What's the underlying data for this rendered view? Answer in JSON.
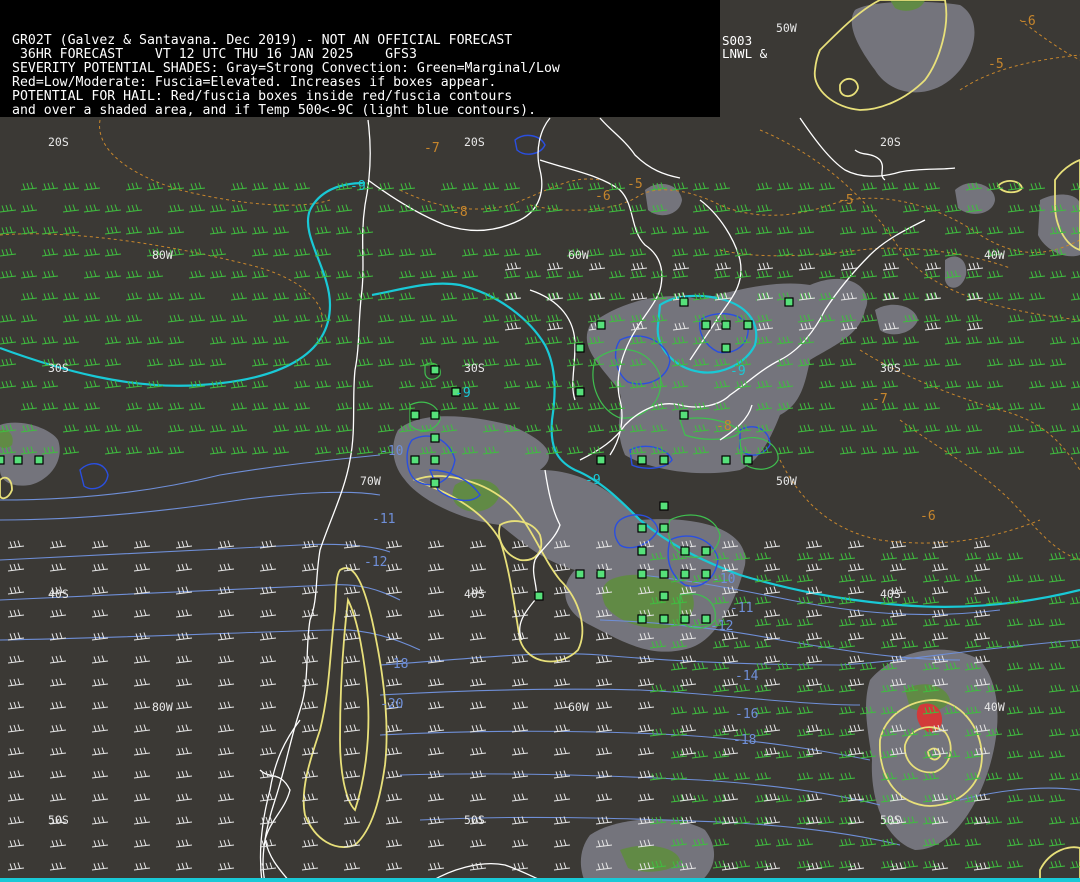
{
  "header": {
    "lines": [
      "GR02T (Galvez & Santavana. Dec 2019) - NOT AN OFFICIAL FORECAST",
      " 36HR FORECAST    VT 12 UTC THU 16 JAN 2025    GFS3",
      "SEVERITY POTENTIAL SHADES: Gray=Strong Convection: Green=Marginal/Low",
      "Red=Low/Moderate: Fuscia=Elevated. Increases if boxes appear.",
      "POTENTIAL FOR HAIL: Red/fuscia boxes inside red/fuscia contours",
      "and over a shaded area, and if Temp 500<-9C (light blue contours)."
    ],
    "corner_code_1": "S003",
    "corner_code_2": "LNWL &"
  },
  "grid_labels": {
    "lat_20s": "20S",
    "lat_30s": "30S",
    "lat_40s": "40S",
    "lat_50s": "50S",
    "lon_80w": "80W",
    "lon_70w": "70W",
    "lon_60w": "60W",
    "lon_50w": "50W",
    "lon_40w": "40W"
  },
  "isotherm_labels": {
    "m5": "-5",
    "m6": "-6",
    "m7": "-7",
    "m8": "-8",
    "m9": "-9",
    "m10": "-10",
    "m11": "-11",
    "m12": "-12",
    "m14": "-14",
    "m16": "-16",
    "m18": "-18",
    "m20": "-20"
  },
  "colors": {
    "background": "#3b3935",
    "coastline": "#ffffff",
    "hail_threshold_contour": "#19c9d6",
    "temperature_contour": "#c7862c",
    "cold_contour": "#6f8fd8",
    "gray_shade": "#7b7b84",
    "green_shade": "#5e8e3c",
    "red_shade": "#d23a3a",
    "yellow_contour": "#e8e07a",
    "blue_contour": "#2a4fe0",
    "green_contour": "#3fc04f",
    "wind_barb_green": "#3fbf3f",
    "wind_barb_white": "#e6e6e6",
    "box_green": "#56e07a"
  }
}
